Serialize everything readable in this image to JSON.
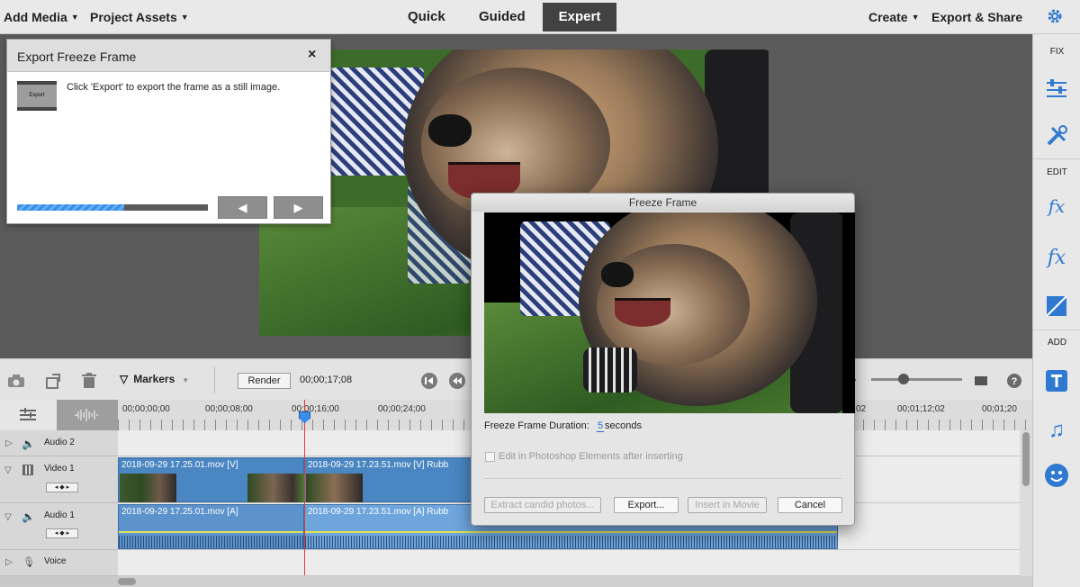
{
  "topbar": {
    "menu_left": [
      "Add Media",
      "Project Assets"
    ],
    "modes": [
      "Quick",
      "Guided",
      "Expert"
    ],
    "active_mode": "Expert",
    "menu_right": [
      "Create",
      "Export & Share"
    ],
    "settings_icon": "gear-icon"
  },
  "right_panel": {
    "fix_label": "FIX",
    "edit_label": "EDIT",
    "add_label": "ADD",
    "icons": [
      "adjustments-icon",
      "tools-icon",
      "applied-effects-icon",
      "effects-icon",
      "transitions-icon",
      "titles-icon",
      "music-icon",
      "graphics-icon"
    ]
  },
  "export_panel": {
    "title": "Export Freeze Frame",
    "close": "×",
    "thumb_label": "Export",
    "message": "Click 'Export' to export the frame as a still image.",
    "progress": 0.56,
    "prev_icon": "◀",
    "next_icon": "▶"
  },
  "timeline": {
    "markers_label": "Markers",
    "render_label": "Render",
    "timecode": "00;00;17;08",
    "ruler_labels": [
      "00;00;00;00",
      "00;00;08;00",
      "00;00;16;00",
      "00;00;24;00",
      "02",
      "00;01;12;02",
      "00;01;20"
    ],
    "tracks": [
      {
        "name": "Audio 2"
      },
      {
        "name": "Video 1"
      },
      {
        "name": "Audio 1"
      },
      {
        "name": "Voice"
      }
    ],
    "clips": {
      "video_a": "2018-09-29 17.25.01.mov [V]",
      "video_b": "2018-09-29 17.23.51.mov [V] Rubb",
      "audio_a": "2018-09-29 17.25.01.mov [A]",
      "audio_b": "2018-09-29 17.23.51.mov [A] Rubb"
    }
  },
  "freeze_dialog": {
    "title": "Freeze Frame",
    "duration_label": "Freeze Frame Duration:",
    "duration_value": "5",
    "duration_unit": "seconds",
    "edit_checkbox_label": "Edit in Photoshop Elements after inserting",
    "buttons": {
      "extract": "Extract candid photos...",
      "export": "Export...",
      "insert": "Insert in Movie",
      "cancel": "Cancel"
    }
  },
  "colors": {
    "accent": "#3a8ee8",
    "clip_video": "#4a86c2",
    "clip_audio": "#5c93cc",
    "playhead": "#e23a3a"
  }
}
